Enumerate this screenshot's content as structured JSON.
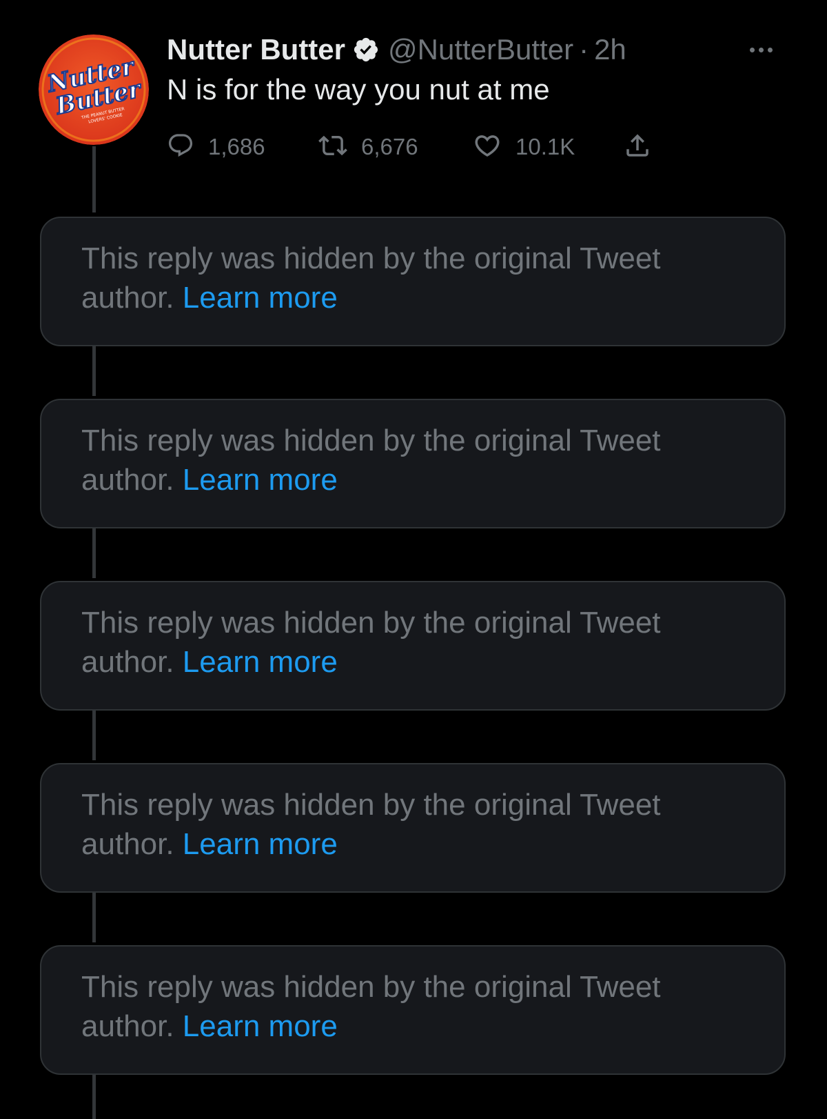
{
  "tweet": {
    "avatar": {
      "line1": "Nutter",
      "line2": "Butter",
      "tagline1": "THE PEANUT BUTTER",
      "tagline2": "LOVERS' COOKIE"
    },
    "display_name": "Nutter Butter",
    "handle": "@NutterButter",
    "separator": "·",
    "time": "2h",
    "text": "N is for the way you nut at me",
    "stats": {
      "replies": "1,686",
      "retweets": "6,676",
      "likes": "10.1K"
    }
  },
  "hidden_replies": [
    {
      "message": "This reply was hidden by the original Tweet author.",
      "link": "Learn more"
    },
    {
      "message": "This reply was hidden by the original Tweet author.",
      "link": "Learn more"
    },
    {
      "message": "This reply was hidden by the original Tweet author.",
      "link": "Learn more"
    },
    {
      "message": "This reply was hidden by the original Tweet author.",
      "link": "Learn more"
    },
    {
      "message": "This reply was hidden by the original Tweet author.",
      "link": "Learn more"
    }
  ],
  "icons": {
    "verified": "verified-badge-icon",
    "more": "more-dots-icon",
    "reply": "reply-bubble-icon",
    "retweet": "retweet-icon",
    "like": "heart-icon",
    "share": "share-upload-icon"
  },
  "colors": {
    "background": "#000000",
    "card": "#16181c",
    "muted_text": "#71767b",
    "link": "#1d9bf0",
    "primary_text": "#e7e9ea",
    "avatar_red": "#e03a1e",
    "avatar_orange": "#f7941d"
  }
}
